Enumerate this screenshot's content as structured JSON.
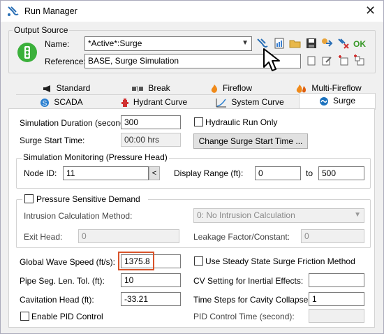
{
  "window": {
    "title": "Run Manager",
    "close_glyph": "✕"
  },
  "output_source": {
    "group_label": "Output Source",
    "name_label": "Name:",
    "name_value": "*Active*:Surge",
    "reference_label": "Reference:",
    "reference_value": "BASE, Surge Simulation",
    "ok_label": "OK",
    "toolbar_icons": [
      "compute-icon",
      "report-icon",
      "open-folder-icon",
      "save-icon",
      "properties-icon",
      "delete-icon"
    ],
    "reference_icons": [
      "copy-icon",
      "edit-icon",
      "new-icon",
      "new-child-icon"
    ]
  },
  "tabs_row1": [
    {
      "label": "Standard",
      "icon": "bullhorn-icon"
    },
    {
      "label": "Break",
      "icon": "pipe-break-icon"
    },
    {
      "label": "Fireflow",
      "icon": "flame-icon"
    },
    {
      "label": "Multi-Fireflow",
      "icon": "multi-flame-icon"
    }
  ],
  "tabs_row2": [
    {
      "label": "SCADA",
      "icon": "scada-icon"
    },
    {
      "label": "Hydrant Curve",
      "icon": "hydrant-icon"
    },
    {
      "label": "System Curve",
      "icon": "system-curve-icon"
    },
    {
      "label": "Surge",
      "icon": "surge-icon",
      "active": true
    }
  ],
  "surge": {
    "sim_duration_label": "Simulation Duration (second):",
    "sim_duration_value": "300",
    "hydraulic_run_only_label": "Hydraulic Run Only",
    "hydraulic_run_only_checked": false,
    "surge_start_label": "Surge Start Time:",
    "surge_start_value": "00:00 hrs",
    "change_start_button": "Change Surge Start Time ...",
    "monitoring": {
      "group_label": "Simulation Monitoring (Pressure Head)",
      "node_id_label": "Node ID:",
      "node_id_value": "11",
      "node_btn": "<",
      "display_range_label": "Display Range (ft):",
      "range_from": "0",
      "to_label": "to",
      "range_to": "500"
    },
    "psd": {
      "label": "Pressure Sensitive Demand",
      "checked": false,
      "intrusion_label": "Intrusion Calculation Method:",
      "intrusion_value": "0: No Intrusion Calculation",
      "exit_head_label": "Exit Head:",
      "exit_head_value": "0",
      "leakage_label": "Leakage Factor/Constant:",
      "leakage_value": "0"
    },
    "wave_speed_label": "Global Wave Speed (ft/s):",
    "wave_speed_value": "1375.8",
    "steady_friction_label": "Use Steady State Surge Friction Method",
    "steady_friction_checked": false,
    "pipe_seg_label": "Pipe Seg. Len. Tol. (ft):",
    "pipe_seg_value": "10",
    "cv_setting_label": "CV Setting for Inertial Effects:",
    "cv_setting_value": "",
    "cavitation_label": "Cavitation Head (ft):",
    "cavitation_value": "-33.21",
    "time_steps_label": "Time Steps for Cavity Collapse:",
    "time_steps_value": "1",
    "enable_pid_label": "Enable PID Control",
    "enable_pid_checked": false,
    "pid_time_label": "PID Control Time (second):",
    "pid_time_value": ""
  },
  "colors": {
    "highlight": "#d8532a",
    "ok_green": "#3a9a2a",
    "tab_active": "#ffffff",
    "surge_blue": "#1e73be"
  }
}
